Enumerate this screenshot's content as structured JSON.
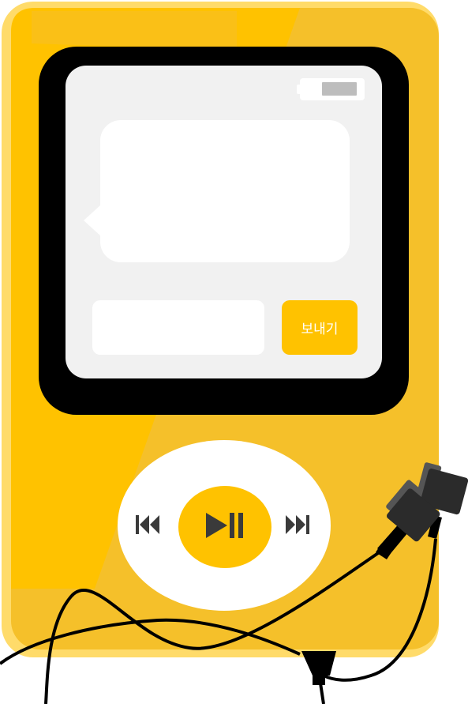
{
  "player": {
    "body_color": "#ffc200",
    "bezel_color": "#000000",
    "screen_color": "#f1f1f1",
    "wheel_color": "#ffffff",
    "earbud_color": "#2b2b2b"
  },
  "screen": {
    "battery_icon": "battery-icon",
    "message_bubble_text": "",
    "message_input_value": "",
    "send_button_label": "보내기",
    "send_button_color": "#ffc200"
  },
  "controls": {
    "prev_icon": "previous-track-icon",
    "play_pause_icon": "play-pause-icon",
    "next_icon": "next-track-icon"
  }
}
